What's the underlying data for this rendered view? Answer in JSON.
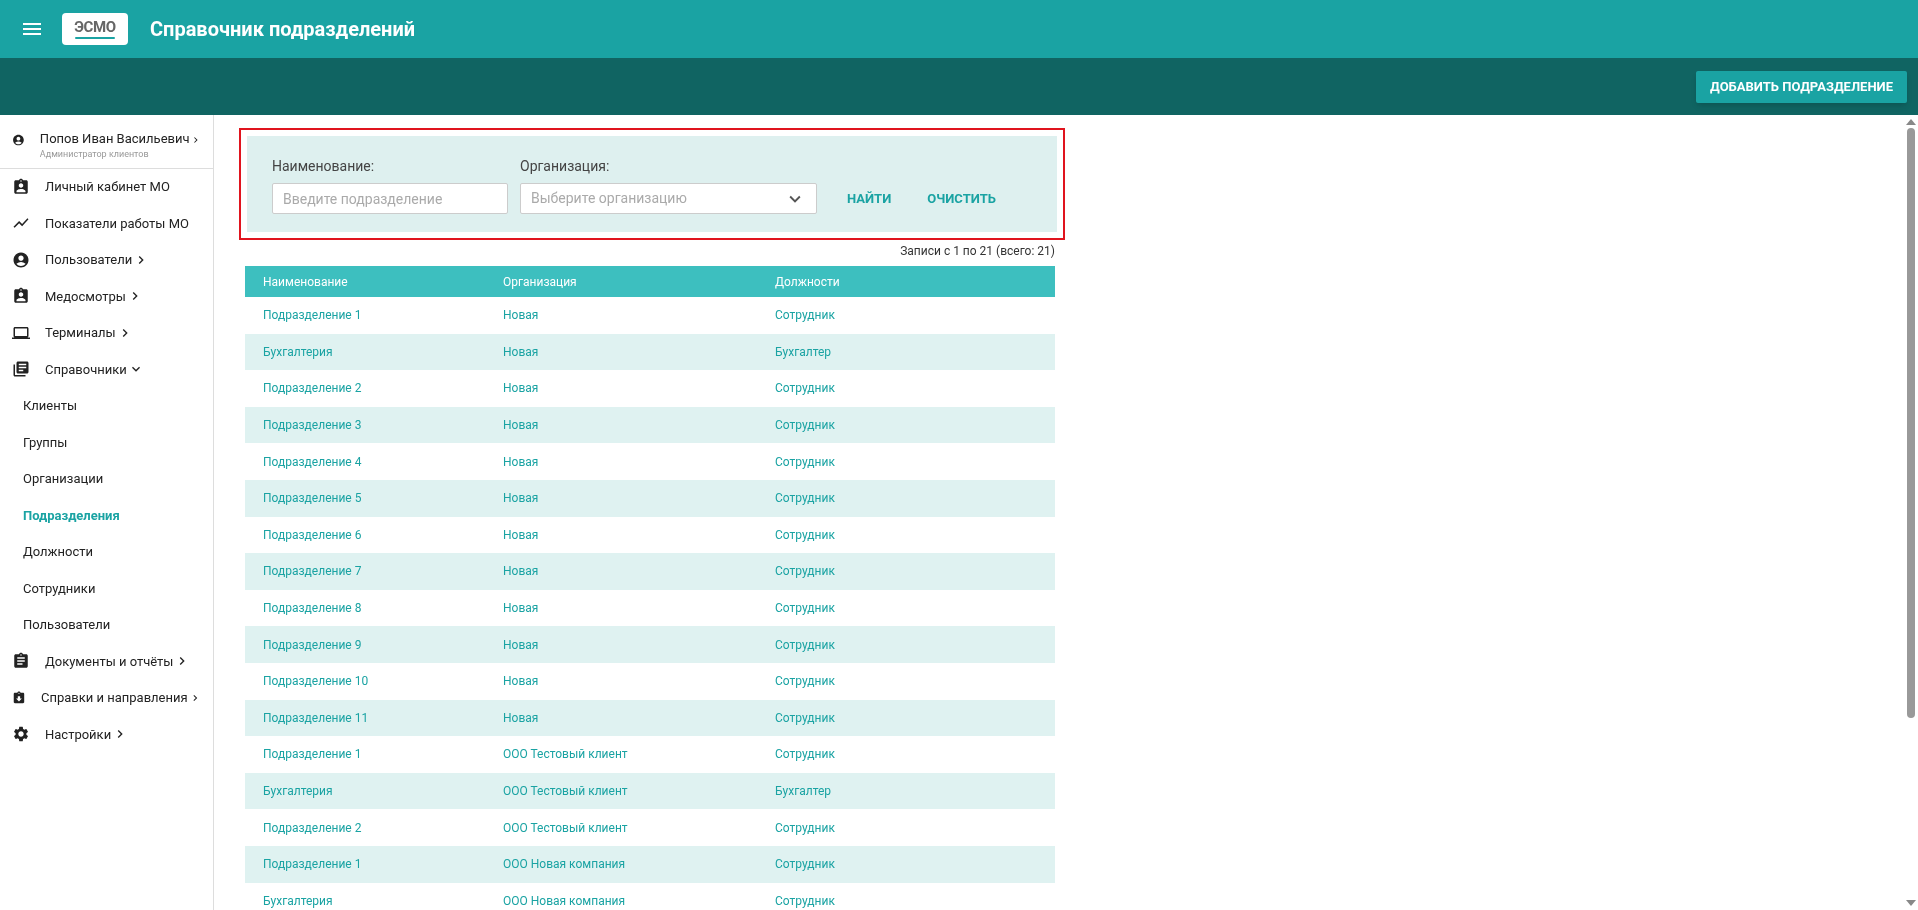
{
  "header": {
    "logo": "ЭСМО",
    "title": "Справочник подразделений"
  },
  "toolbar": {
    "add_button": "ДОБАВИТЬ ПОДРАЗДЕЛЕНИЕ"
  },
  "sidebar": {
    "user": {
      "name": "Попов Иван Васильевич",
      "role": "Администратор клиентов"
    },
    "items": [
      {
        "label": "Личный кабинет МО",
        "kind": "link"
      },
      {
        "label": "Показатели работы МО",
        "kind": "link"
      },
      {
        "label": "Пользователи",
        "kind": "group",
        "expanded": false
      },
      {
        "label": "Медосмотры",
        "kind": "group",
        "expanded": false
      },
      {
        "label": "Терминалы",
        "kind": "group",
        "expanded": false
      },
      {
        "label": "Справочники",
        "kind": "group",
        "expanded": true,
        "children": [
          {
            "label": "Клиенты",
            "selected": false
          },
          {
            "label": "Группы",
            "selected": false
          },
          {
            "label": "Организации",
            "selected": false
          },
          {
            "label": "Подразделения",
            "selected": true
          },
          {
            "label": "Должности",
            "selected": false
          },
          {
            "label": "Сотрудники",
            "selected": false
          },
          {
            "label": "Пользователи",
            "selected": false
          }
        ]
      },
      {
        "label": "Документы и отчёты",
        "kind": "group",
        "expanded": false
      },
      {
        "label": "Справки и направления",
        "kind": "group",
        "expanded": false
      },
      {
        "label": "Настройки",
        "kind": "group",
        "expanded": false
      }
    ]
  },
  "filter": {
    "name_label": "Наименование:",
    "name_placeholder": "Введите подразделение",
    "org_label": "Организация:",
    "org_placeholder": "Выберите организацию",
    "find_button": "НАЙТИ",
    "clear_button": "ОЧИСТИТЬ"
  },
  "records": "Записи с 1 по 21 (всего: 21)",
  "table": {
    "columns": [
      "Наименование",
      "Организация",
      "Должности"
    ],
    "rows": [
      [
        "Подразделение 1",
        "Новая",
        "Сотрудник"
      ],
      [
        "Бухгалтерия",
        "Новая",
        "Бухгалтер"
      ],
      [
        "Подразделение 2",
        "Новая",
        "Сотрудник"
      ],
      [
        "Подразделение 3",
        "Новая",
        "Сотрудник"
      ],
      [
        "Подразделение 4",
        "Новая",
        "Сотрудник"
      ],
      [
        "Подразделение 5",
        "Новая",
        "Сотрудник"
      ],
      [
        "Подразделение 6",
        "Новая",
        "Сотрудник"
      ],
      [
        "Подразделение 7",
        "Новая",
        "Сотрудник"
      ],
      [
        "Подразделение 8",
        "Новая",
        "Сотрудник"
      ],
      [
        "Подразделение 9",
        "Новая",
        "Сотрудник"
      ],
      [
        "Подразделение 10",
        "Новая",
        "Сотрудник"
      ],
      [
        "Подразделение 11",
        "Новая",
        "Сотрудник"
      ],
      [
        "Подразделение 1",
        "ООО Тестовый клиент",
        "Сотрудник"
      ],
      [
        "Бухгалтерия",
        "ООО Тестовый клиент",
        "Бухгалтер"
      ],
      [
        "Подразделение 2",
        "ООО Тестовый клиент",
        "Сотрудник"
      ],
      [
        "Подразделение 1",
        "ООО Новая компания",
        "Сотрудник"
      ],
      [
        "Бухгалтерия",
        "ООО Новая компания",
        "Сотрудник"
      ]
    ]
  }
}
